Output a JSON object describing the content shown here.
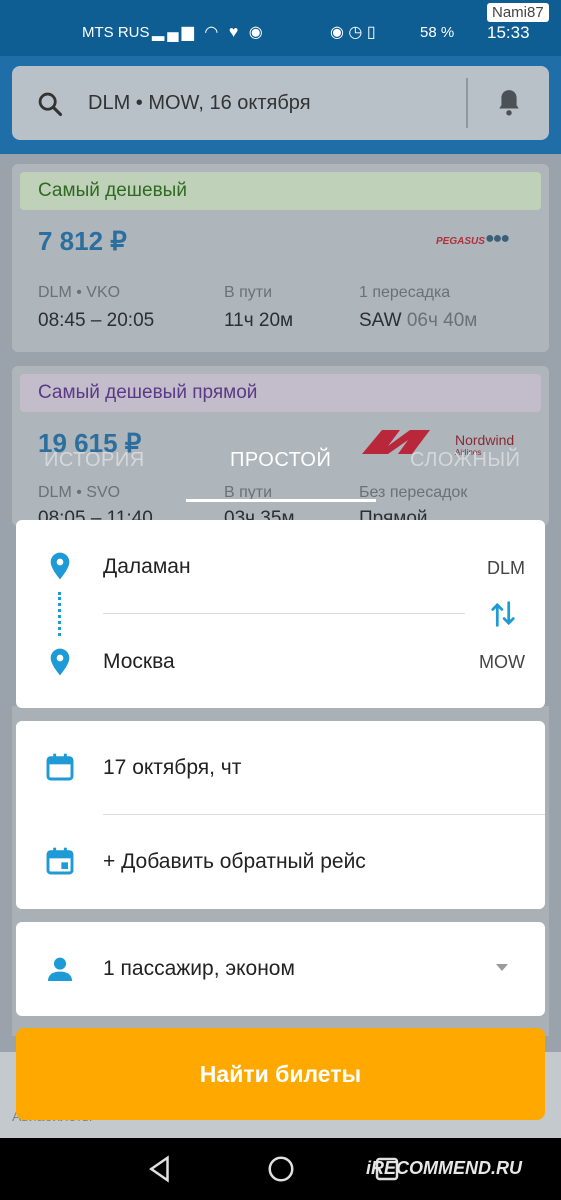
{
  "status_bar": {
    "carrier": "MTS RUS",
    "battery": "58 %",
    "time": "15:33",
    "watermark": "Nami87"
  },
  "search": {
    "query": "DLM • MOW, 16 октября",
    "icon": "search-icon",
    "notifications_icon": "bell-icon"
  },
  "results": [
    {
      "badge": "Самый дешевый",
      "badge_color": "#3a8a2a",
      "price": "7 812 ₽",
      "airline": "PEGASUS",
      "route": "DLM • VKO",
      "times": "08:45 – 20:05",
      "duration_label": "В пути",
      "duration": "11ч 20м",
      "stops_label": "1 пересадка",
      "stop_airport": "SAW",
      "stop_duration": "06ч 40м"
    },
    {
      "badge": "Самый дешевый прямой",
      "badge_color": "#6a3f9c",
      "price": "19 615 ₽",
      "airline": "Nordwind",
      "airline_sub": "Airlines",
      "route": "DLM • SVO",
      "times": "08:05 – 11:40",
      "duration_label": "В пути",
      "duration": "03ч 35м",
      "stops_label": "Без пересадок",
      "stop_type": "Прямой"
    }
  ],
  "tabs": [
    {
      "label": "История",
      "active": false
    },
    {
      "label": "Простой",
      "active": true
    },
    {
      "label": "Сложный",
      "active": false
    }
  ],
  "route_form": {
    "origin": "Даламан",
    "origin_code": "DLM",
    "destination": "Москва",
    "destination_code": "MOW"
  },
  "dates_form": {
    "departure": "17 октября, чт",
    "add_return": "+ Добавить обратный рейс"
  },
  "passengers_form": {
    "value": "1 пассажир, эконом"
  },
  "find_button": "Найти билеты",
  "background_footer": "Авиабилеты",
  "watermark_bottom": "iRECOMMEND.RU",
  "colors": {
    "accent": "#1e9ad6",
    "header": "#1f6ea7",
    "button": "#ffa800"
  }
}
